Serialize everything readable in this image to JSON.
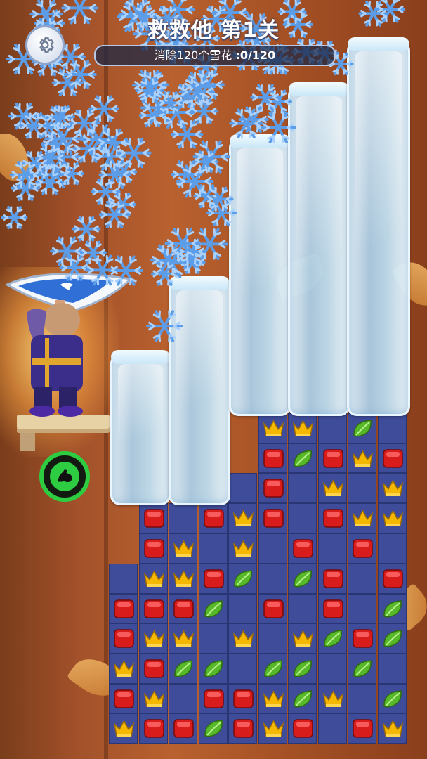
{
  "level_title": "救救他  第1关",
  "goal": {
    "label": "消除120个雪花 ",
    "progress": ":0/120",
    "collected": 0,
    "target": 120
  },
  "icons": {
    "settings": "gear-icon",
    "power": "muscle-arm-icon",
    "shield": "shield-icon"
  },
  "colors": {
    "board_cell": "#3e4c9a",
    "gem_red": "#d81b1b",
    "gem_crown": "#f5b800",
    "gem_leaf": "#57b82a",
    "power_ring": "#2ecc40"
  },
  "ice_columns": [
    {
      "column": 1,
      "top_row": 3
    },
    {
      "column": 2,
      "top_row": 2
    },
    {
      "column": 3,
      "top_row": 0
    },
    {
      "column": 4,
      "top_row": 0
    },
    {
      "column": 5,
      "top_row": 0
    }
  ],
  "board_rows": [
    [
      ".",
      ".",
      ".",
      ".",
      ".",
      "C",
      "C",
      "_",
      "L",
      "_"
    ],
    [
      ".",
      ".",
      ".",
      ".",
      ".",
      "R",
      "L",
      "R",
      "C",
      "R"
    ],
    [
      ".",
      ".",
      ".",
      ".",
      "_",
      "R",
      "_",
      "C",
      "_",
      "C"
    ],
    [
      ".",
      "R",
      "_",
      "R",
      "C",
      "R",
      "_",
      "R",
      "C",
      "C"
    ],
    [
      ".",
      "R",
      "C",
      "_",
      "C",
      "_",
      "R",
      "_",
      "R",
      "_"
    ],
    [
      "_",
      "C",
      "C",
      "R",
      "L",
      "_",
      "L",
      "R",
      "_",
      "R"
    ],
    [
      "R",
      "R",
      "R",
      "L",
      "_",
      "R",
      "_",
      "R",
      "_",
      "L"
    ],
    [
      "R",
      "C",
      "C",
      "_",
      "C",
      "_",
      "C",
      "L",
      "R",
      "L"
    ],
    [
      "C",
      "R",
      "L",
      "L",
      "_",
      "L",
      "L",
      "_",
      "L",
      "_"
    ],
    [
      "R",
      "C",
      "_",
      "R",
      "R",
      "C",
      "L",
      "C",
      "_",
      "L"
    ],
    [
      "C",
      "R",
      "R",
      "L",
      "R",
      "C",
      "R",
      "_",
      "R",
      "C"
    ]
  ]
}
